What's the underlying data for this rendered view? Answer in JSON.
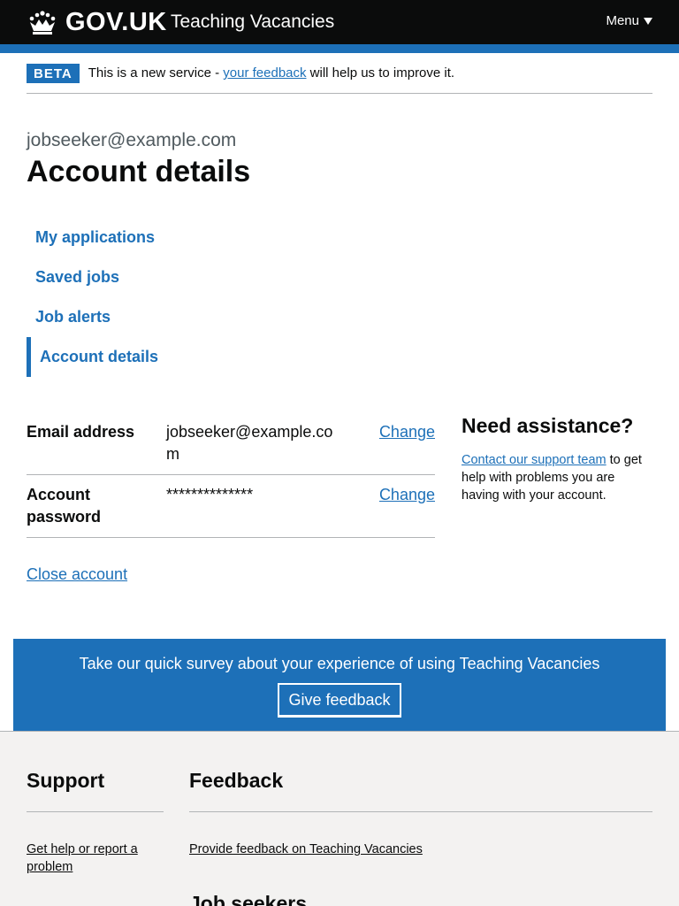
{
  "header": {
    "logo_text": "GOV.UK",
    "service_name": "Teaching Vacancies",
    "menu_label": "Menu"
  },
  "phase_banner": {
    "tag": "BETA",
    "text_before": "This is a new service - ",
    "link_text": "your feedback",
    "text_after": " will help us to improve it."
  },
  "page": {
    "caption": "jobseeker@example.com",
    "title": "Account details"
  },
  "subnav": {
    "items": [
      {
        "label": "My applications"
      },
      {
        "label": "Saved jobs"
      },
      {
        "label": "Job alerts"
      },
      {
        "label": "Account details",
        "active": true
      }
    ]
  },
  "summary": {
    "rows": [
      {
        "key": "Email address",
        "value": "jobseeker@example.com",
        "action": "Change"
      },
      {
        "key": "Account password",
        "value": "**************",
        "action": "Change"
      }
    ]
  },
  "close_account": "Close account",
  "assistance": {
    "title": "Need assistance?",
    "link_text": "Contact our support team",
    "text_after": " to get help with problems you are having with your account."
  },
  "survey": {
    "text": "Take our quick survey about your experience of using Teaching Vacancies",
    "button": "Give feedback"
  },
  "footer": {
    "support_heading": "Support",
    "support_link": "Get help or report a problem",
    "feedback_heading": "Feedback",
    "feedback_link": "Provide feedback on Teaching Vacancies",
    "jobseekers_heading": "Job seekers"
  },
  "colors": {
    "header_bg": "#0b0c0c",
    "brand_blue": "#1d70b8",
    "footer_bg": "#f3f2f1"
  }
}
